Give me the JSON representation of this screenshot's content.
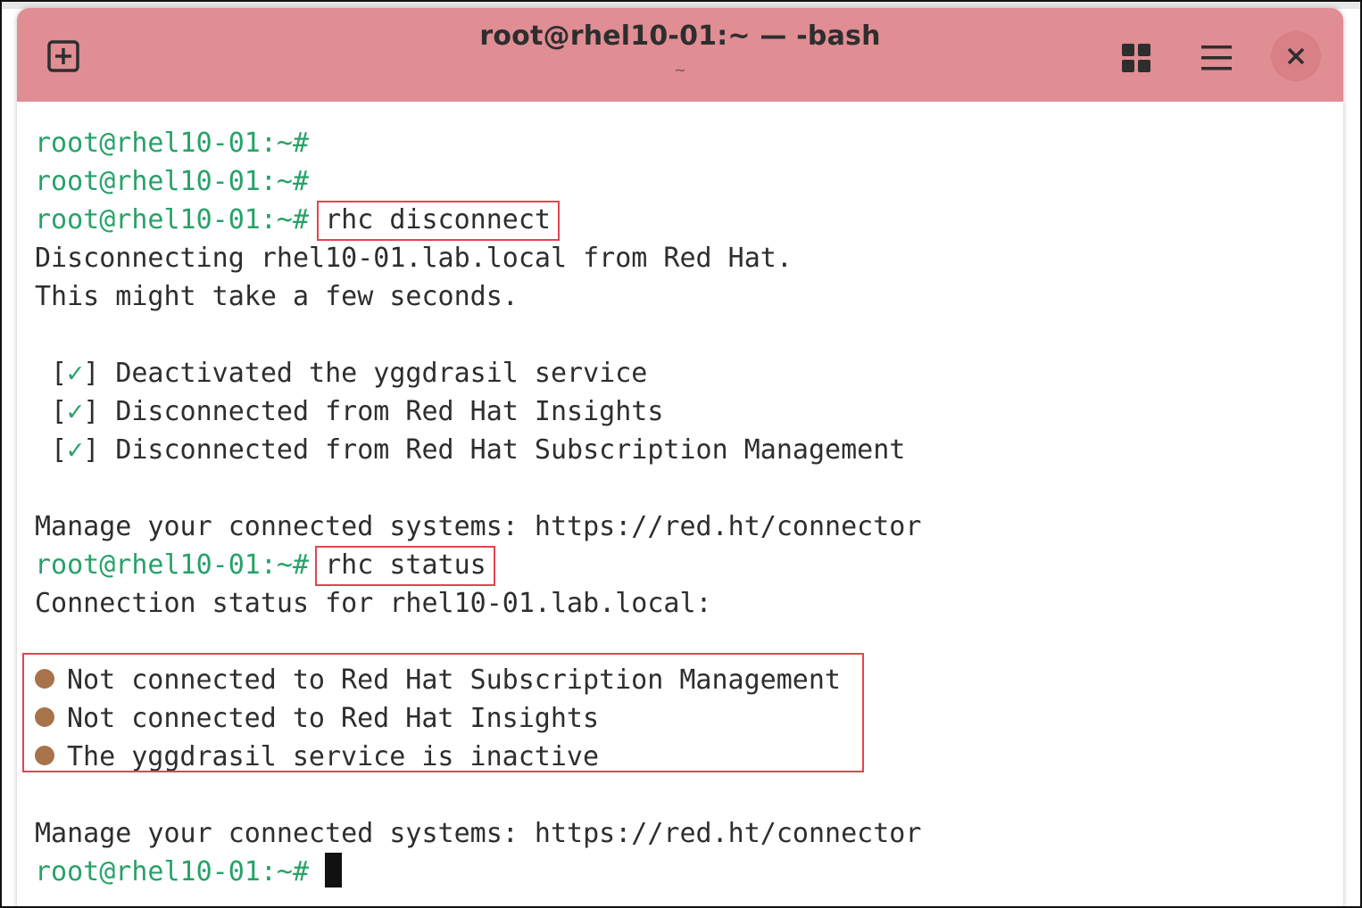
{
  "window": {
    "title": "root@rhel10-01:~ — -bash",
    "subtitle": "~"
  },
  "icons": {
    "new_tab": "new-tab-icon",
    "view": "grid-view-icon",
    "menu": "hamburger-menu-icon",
    "close": "close-icon",
    "bullet_color": "#a8734a",
    "prompt_color": "#26a269",
    "highlight_color": "#e5434f"
  },
  "terminal": {
    "prompt": "root@rhel10-01:~#",
    "lines": [
      {
        "prompt": "root@rhel10-01:~#",
        "text": ""
      },
      {
        "prompt": "root@rhel10-01:~#",
        "text": ""
      },
      {
        "prompt": "root@rhel10-01:~#",
        "text": " rhc disconnect"
      },
      {
        "text": "Disconnecting rhel10-01.lab.local from Red Hat."
      },
      {
        "text": "This might take a few seconds."
      },
      {
        "text": ""
      },
      {
        "open": " [",
        "check": "✓",
        "close": "] ",
        "text": "Deactivated the yggdrasil service"
      },
      {
        "open": " [",
        "check": "✓",
        "close": "] ",
        "text": "Disconnected from Red Hat Insights"
      },
      {
        "open": " [",
        "check": "✓",
        "close": "] ",
        "text": "Disconnected from Red Hat Subscription Management"
      },
      {
        "text": ""
      },
      {
        "text": "Manage your connected systems: https://red.ht/connector"
      },
      {
        "prompt": "root@rhel10-01:~#",
        "text": " rhc status"
      },
      {
        "text": "Connection status for rhel10-01.lab.local:"
      },
      {
        "text": ""
      },
      {
        "bullet": true,
        "text": "Not connected to Red Hat Subscription Management"
      },
      {
        "bullet": true,
        "text": "Not connected to Red Hat Insights"
      },
      {
        "bullet": true,
        "text": "The yggdrasil service is inactive"
      },
      {
        "text": ""
      },
      {
        "text": "Manage your connected systems: https://red.ht/connector"
      },
      {
        "prompt": "root@rhel10-01:~#",
        "text": " "
      }
    ]
  }
}
